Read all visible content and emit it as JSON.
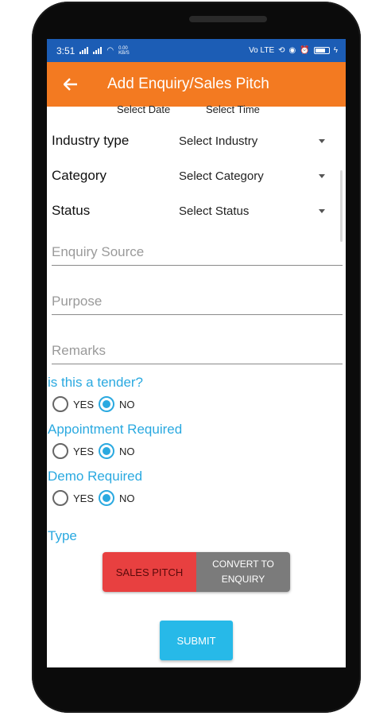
{
  "status_bar": {
    "time": "3:51",
    "net_speed": "0.00 KB/S",
    "right_text": "Vo LTE"
  },
  "app_bar": {
    "title": "Add Enquiry/Sales Pitch",
    "back_icon": "arrow-left-icon"
  },
  "date_time": {
    "date_label": "Select Date",
    "time_label": "Select Time"
  },
  "form": {
    "industry": {
      "label": "Industry type",
      "value": "Select Industry"
    },
    "category": {
      "label": "Category",
      "value": "Select Category"
    },
    "status": {
      "label": "Status",
      "value": "Select Status"
    },
    "enquiry_source": {
      "placeholder": "Enquiry Source"
    },
    "purpose": {
      "placeholder": "Purpose"
    },
    "remarks": {
      "placeholder": "Remarks"
    }
  },
  "questions": {
    "tender": {
      "label": "is this a tender?",
      "yes": "YES",
      "no": "NO",
      "selected": "NO"
    },
    "appointment": {
      "label": "Appointment Required",
      "yes": "YES",
      "no": "NO",
      "selected": "NO"
    },
    "demo": {
      "label": "Demo Required",
      "yes": "YES",
      "no": "NO",
      "selected": "NO"
    }
  },
  "type": {
    "label": "Type",
    "option_sales": "SALES PITCH",
    "option_convert": "CONVERT TO\nENQUIRY",
    "selected": "SALES PITCH"
  },
  "submit_label": "SUBMIT",
  "colors": {
    "status_bar": "#1c5db5",
    "app_bar": "#f37a21",
    "accent": "#2aa9e0",
    "sales_pitch": "#e84040",
    "convert": "#7b7b7b",
    "submit": "#27b9e8"
  }
}
